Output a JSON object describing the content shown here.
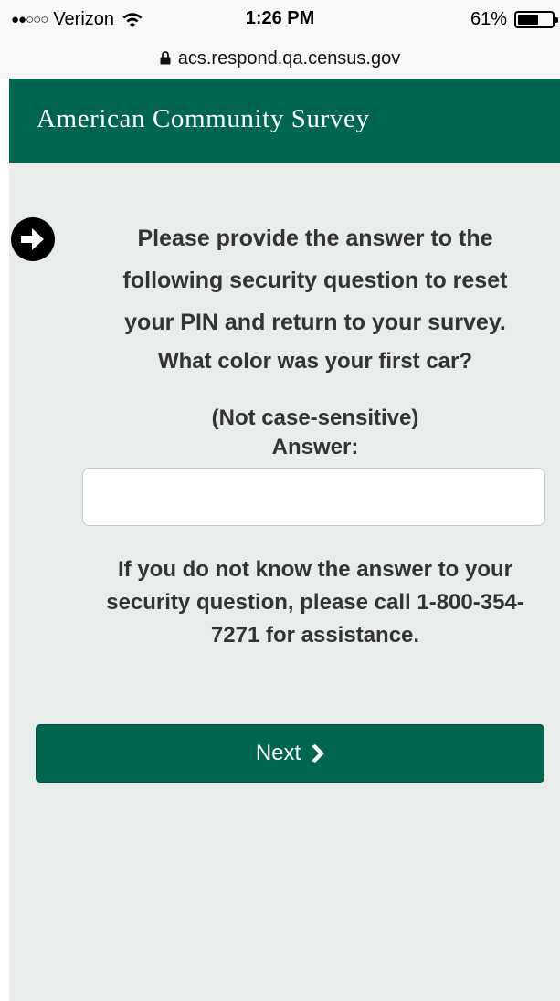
{
  "status_bar": {
    "carrier": "Verizon",
    "signal_dots": "●●○○○",
    "time": "1:26 PM",
    "battery": "61%",
    "battery_level": 0.61
  },
  "url_bar": {
    "url": "acs.respond.qa.census.gov"
  },
  "header": {
    "title": "American Community Survey"
  },
  "main": {
    "prompt": "Please provide the answer to the following security question to reset your PIN and return to your survey.",
    "question": "What color was your first car?",
    "case_note": "(Not case-sensitive)",
    "answer_label": "Answer:",
    "answer_value": "",
    "answer_placeholder": "",
    "help_text": "If you do not know the answer to your security question, please call 1-800-354-7271 for assistance.",
    "next_label": "Next"
  },
  "colors": {
    "brand_green": "#006652",
    "content_background": "#e8ecea",
    "text": "#333333"
  },
  "icons": {
    "wifi": "wifi-icon",
    "battery": "battery-icon",
    "lock": "lock-icon",
    "arrow": "arrow-circle-right-icon",
    "chevron": "chevron-right-icon"
  }
}
